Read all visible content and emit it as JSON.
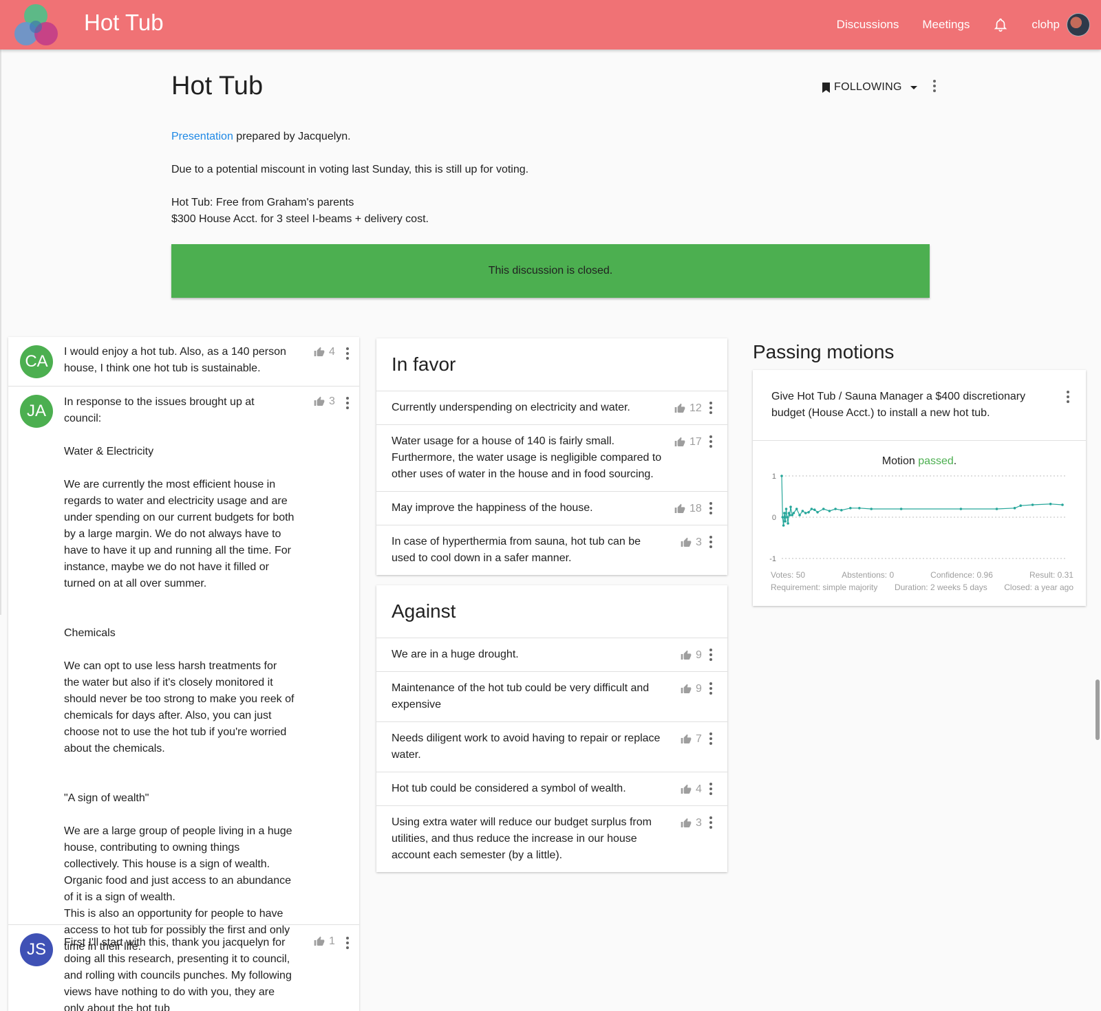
{
  "header": {
    "app_title": "Hot Tub",
    "nav": [
      {
        "label": "Discussions"
      },
      {
        "label": "Meetings"
      }
    ],
    "bell_icon": "bell-icon",
    "username": "clohp",
    "brand_color": "#f07275"
  },
  "discussion": {
    "title": "Hot Tub",
    "follow_label": "FOLLOWING",
    "desc": {
      "link_text": "Presentation",
      "line1_rest": " prepared by Jacquelyn.",
      "line2": "Due to a potential miscount in voting last Sunday, this is still up for voting.",
      "line3": "Hot Tub: Free from Graham's parents",
      "line4": "$300 House Acct. for 3 steel I-beams + delivery cost."
    },
    "closed_text": "This discussion is closed.",
    "closed_color": "#4caf50"
  },
  "comments": [
    {
      "initials": "CA",
      "color": "#4caf50",
      "votes": "4",
      "paragraphs": [
        "I would enjoy a hot tub. Also, as a 140 person house, I think one hot tub is sustainable."
      ]
    },
    {
      "initials": "JA",
      "color": "#4caf50",
      "votes": "3",
      "paragraphs": [
        "In response to the issues brought up at council:",
        "Water & Electricity",
        "We are currently the most efficient house in regards to water and electricity usage and are under spending on our current budgets for both by a large margin. We do not always have to have to have it up and running all the time. For instance, maybe we do not have it filled or turned on at all over summer.",
        "Chemicals",
        "We can opt to use less harsh treatments for the water but also if it's closely monitored it should never be too strong to make you reek of chemicals for days after. Also, you can just choose not to use the hot tub if you're worried about the chemicals.",
        "\"A sign of wealth\"",
        "We are a large group of people living in a huge house, contributing to owning things collectively. This house is a sign of wealth. Organic food and just access to an abundance of it is a sign of wealth.",
        "This is also an opportunity for people to have access to hot tub for possibly the first and only time in their life."
      ]
    },
    {
      "initials": "JS",
      "color": "#3f51b5",
      "votes": "1",
      "paragraphs": [
        "First I'll start with this, thank you jacquelyn for doing all this research, presenting it to council, and rolling with councils punches. My following views have nothing to do with you, they are only about the hot tub"
      ]
    }
  ],
  "in_favor": {
    "title": "In favor",
    "items": [
      {
        "text": "Currently underspending on electricity and water.",
        "votes": "12"
      },
      {
        "text": "Water usage for a house of 140 is fairly small. Furthermore, the water usage is negligible compared to other uses of water in the house and in food sourcing.",
        "votes": "17"
      },
      {
        "text": "May improve the happiness of the house.",
        "votes": "18"
      },
      {
        "text": "In case of hyperthermia from sauna, hot tub can be used to cool down in a safer manner.",
        "votes": "3"
      }
    ]
  },
  "against": {
    "title": "Against",
    "items": [
      {
        "text": "We are in a huge drought.",
        "votes": "9"
      },
      {
        "text": "Maintenance of the hot tub could be very difficult and expensive",
        "votes": "9"
      },
      {
        "text": "Needs diligent work to avoid having to repair or replace water.",
        "votes": "7"
      },
      {
        "text": "Hot tub could be considered a symbol of wealth.",
        "votes": "4"
      },
      {
        "text": "Using extra water will reduce our budget surplus from utilities, and thus reduce the increase in our house account each semester (by a little).",
        "votes": "3"
      }
    ]
  },
  "passing_motions": {
    "title": "Passing motions",
    "motion_text": "Give Hot Tub / Sauna Manager a $400 discretionary budget (House Acct.) to install a new hot tub.",
    "status_prefix": "Motion ",
    "status_word": "passed",
    "status_suffix": ".",
    "stats_row1": [
      "Votes: 50",
      "Abstentions: 0",
      "Confidence: 0.96",
      "Result: 0.31"
    ],
    "stats_row2": [
      "Requirement: simple majority",
      "Duration: 2 weeks 5 days",
      "Closed: a year ago"
    ],
    "line_color": "#26a69a"
  },
  "chart_data": {
    "type": "line",
    "ylim": [
      -1,
      1
    ],
    "yticks": [
      "1",
      "0",
      "-1"
    ],
    "grid": true,
    "x": [
      0,
      0.3,
      0.6,
      0.9,
      1.2,
      1.5,
      1.8,
      2.1,
      2.4,
      2.7,
      3,
      3.5,
      4,
      5,
      6,
      7,
      8,
      9,
      10,
      11,
      12,
      14,
      16,
      18,
      20,
      23,
      26,
      30,
      40,
      60,
      72,
      78,
      80,
      84,
      90,
      94
    ],
    "values": [
      1,
      0,
      -0.2,
      0.1,
      -0.1,
      0.2,
      0,
      -0.15,
      0.1,
      0.05,
      0.25,
      0.05,
      0.1,
      0.2,
      0.05,
      0.15,
      0.1,
      0.12,
      0.2,
      0.18,
      0.12,
      0.2,
      0.15,
      0.2,
      0.17,
      0.22,
      0.22,
      0.2,
      0.2,
      0.2,
      0.2,
      0.22,
      0.28,
      0.3,
      0.32,
      0.3
    ]
  }
}
